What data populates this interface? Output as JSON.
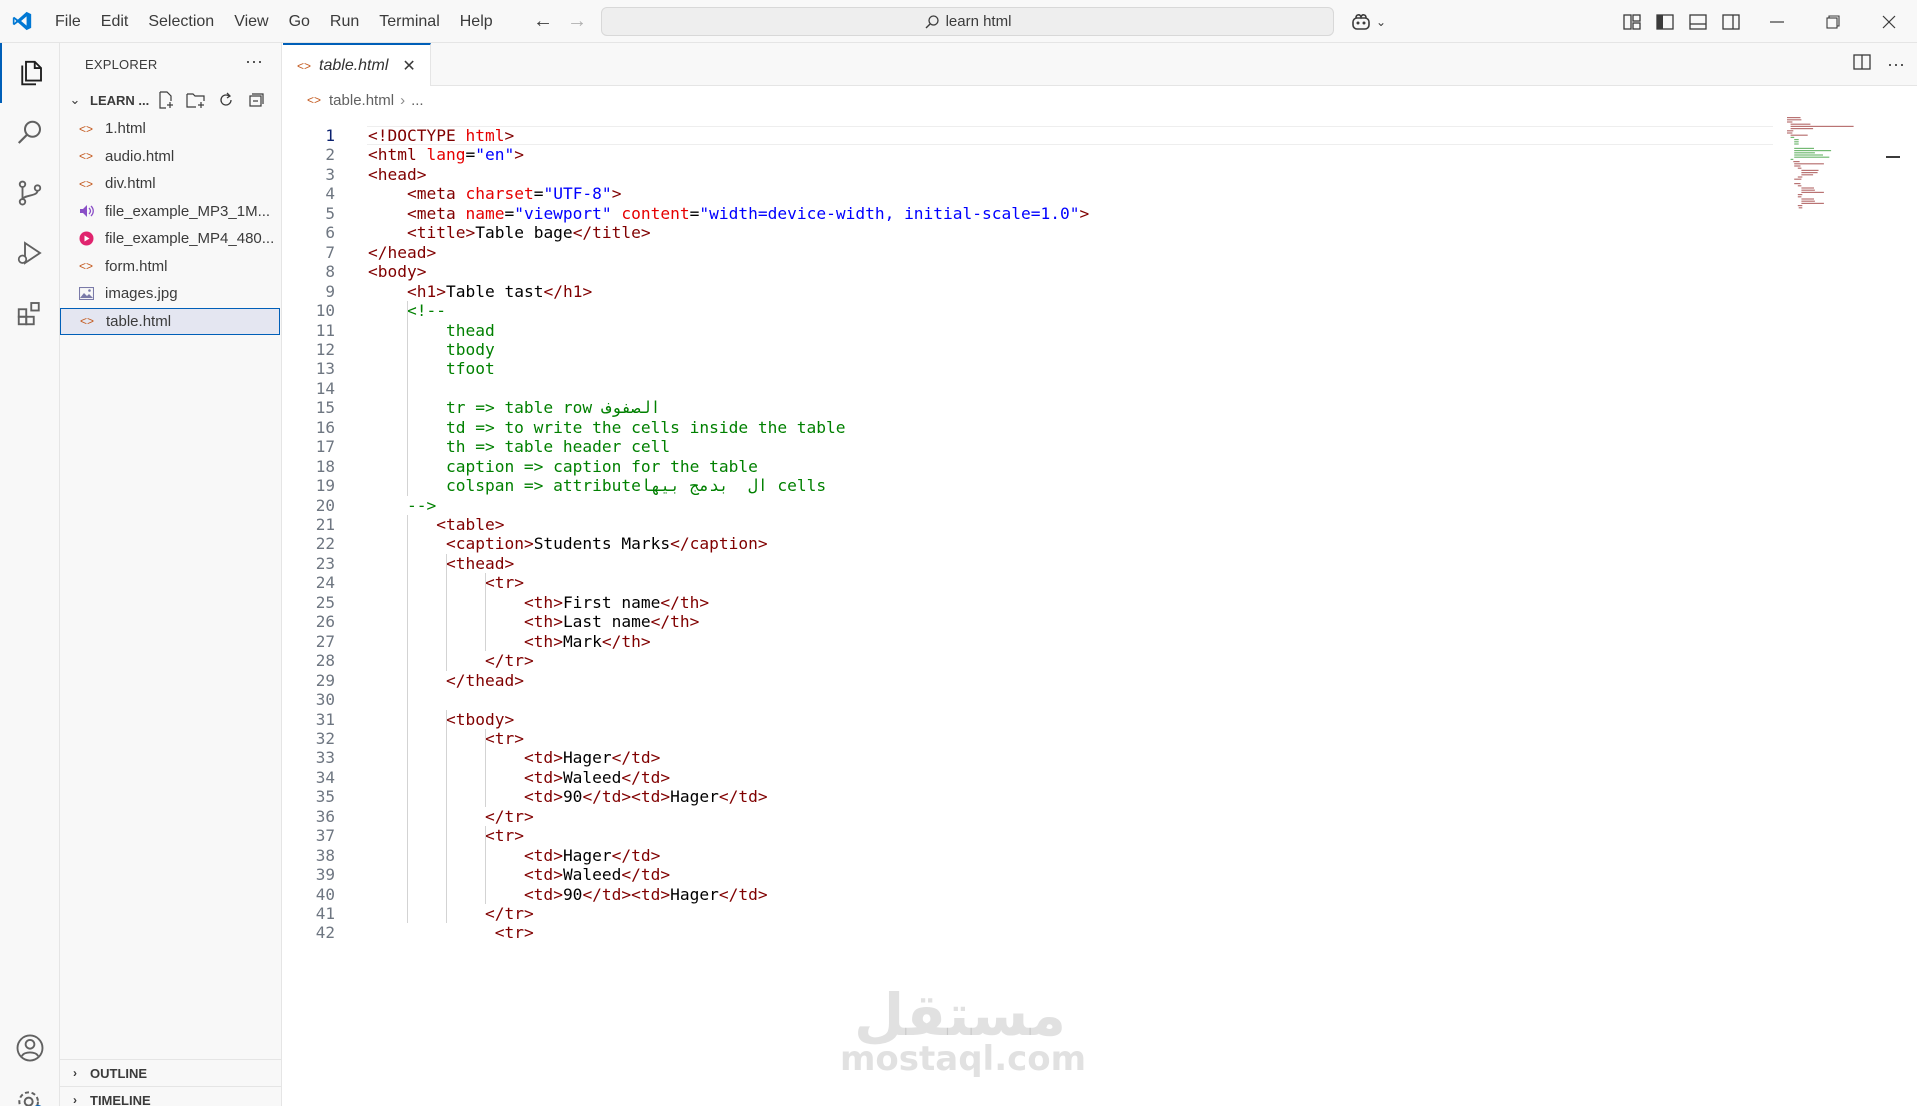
{
  "menu": [
    "File",
    "Edit",
    "Selection",
    "View",
    "Go",
    "Run",
    "Terminal",
    "Help"
  ],
  "command_center": "learn html",
  "sidebar": {
    "title": "EXPLORER",
    "folder": "LEARN ...",
    "files": [
      {
        "name": "1.html",
        "icon": "html-icon"
      },
      {
        "name": "audio.html",
        "icon": "html-icon"
      },
      {
        "name": "div.html",
        "icon": "html-icon"
      },
      {
        "name": "file_example_MP3_1M...",
        "icon": "audio-file-icon"
      },
      {
        "name": "file_example_MP4_480...",
        "icon": "video-file-icon"
      },
      {
        "name": "form.html",
        "icon": "html-icon"
      },
      {
        "name": "images.jpg",
        "icon": "image-file-icon"
      },
      {
        "name": "table.html",
        "icon": "html-icon",
        "selected": true
      }
    ],
    "outline": "OUTLINE",
    "timeline": "TIMELINE"
  },
  "editor": {
    "tab_label": "table.html",
    "breadcrumb_file": "table.html",
    "breadcrumb_more": "...",
    "active_line": 1,
    "lines": [
      "<!DOCTYPE html>",
      "<html lang=\"en\">",
      "<head>",
      "    <meta charset=\"UTF-8\">",
      "    <meta name=\"viewport\" content=\"width=device-width, initial-scale=1.0\">",
      "    <title>Table bage</title>",
      "</head>",
      "<body>",
      "    <h1>Table tast</h1>",
      "    <!--",
      "        thead",
      "        tbody",
      "        tfoot",
      "",
      "        tr => table row الصفوف",
      "        td => to write the cells inside the table",
      "        th => table header cell",
      "        caption => caption for the table",
      "        colspan => attributeال  بدمج بيها cells",
      "    -->",
      "       <table>",
      "        <caption>Students Marks</caption>",
      "        <thead>",
      "            <tr>",
      "                <th>First name</th>",
      "                <th>Last name</th>",
      "                <th>Mark</th>",
      "            </tr>",
      "        </thead>",
      "",
      "        <tbody>",
      "            <tr>",
      "                <td>Hager</td>",
      "                <td>Waleed</td>",
      "                <td>90</td><td>Hager</td>",
      "            </tr>",
      "            <tr>",
      "                <td>Hager</td>",
      "                <td>Waleed</td>",
      "                <td>90</td><td>Hager</td>",
      "            </tr>",
      "             <tr>"
    ]
  },
  "watermark": {
    "arabic": "مستقل",
    "latin": "mostaql.com"
  },
  "colors": {
    "accent": "#005fb8",
    "tag": "#800000",
    "attribute": "#e50000",
    "string": "#0000ff",
    "comment": "#008000"
  }
}
